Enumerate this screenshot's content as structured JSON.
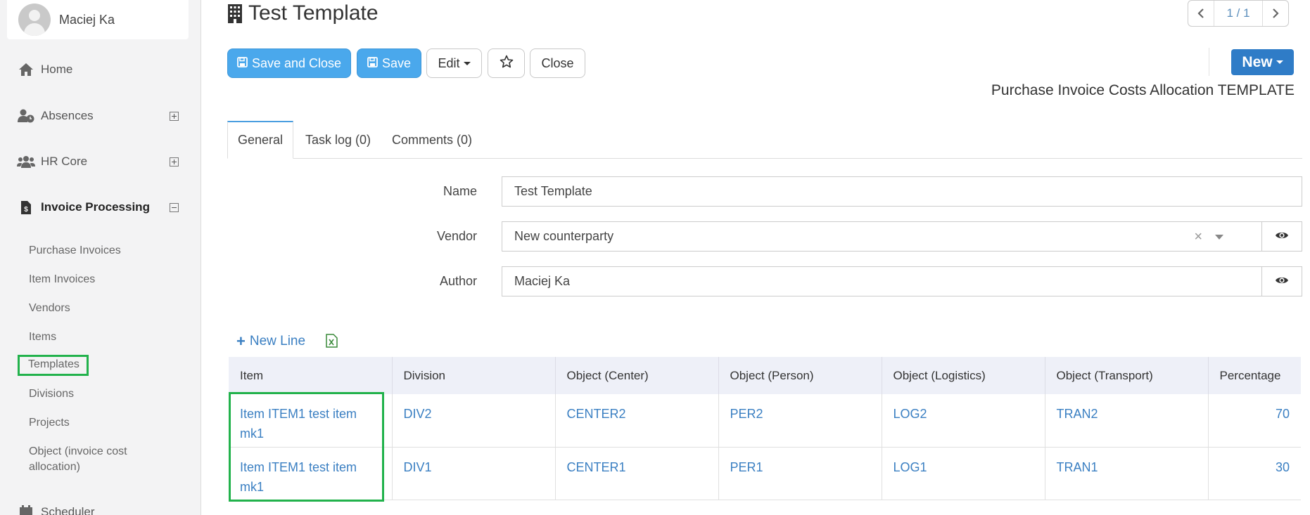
{
  "user": {
    "name": "Maciej Ka"
  },
  "sidebar": {
    "items": [
      {
        "label": "Home",
        "icon": "home-icon"
      },
      {
        "label": "Absences",
        "icon": "user-clock-icon",
        "toggle": "expand"
      },
      {
        "label": "HR Core",
        "icon": "users-icon",
        "toggle": "expand"
      },
      {
        "label": "Invoice Processing",
        "icon": "invoice-dollar-icon",
        "toggle": "collapse"
      }
    ],
    "sub_items": [
      "Purchase Invoices",
      "Item Invoices",
      "Vendors",
      "Items",
      "Templates",
      "Divisions",
      "Projects",
      "Object (invoice cost",
      "allocation)"
    ],
    "bottom_item": "Scheduler"
  },
  "header": {
    "title": "Test Template",
    "title_icon": "building-icon",
    "pager": "1 / 1",
    "subtitle": "Purchase Invoice Costs Allocation TEMPLATE",
    "new_label": "New"
  },
  "toolbar": {
    "save_close": "Save and Close",
    "save": "Save",
    "edit": "Edit",
    "close": "Close"
  },
  "tabs": [
    "General",
    "Task log (0)",
    "Comments (0)"
  ],
  "form": {
    "name_label": "Name",
    "name_value": "Test Template",
    "vendor_label": "Vendor",
    "vendor_value": "New counterparty",
    "author_label": "Author",
    "author_value": "Maciej Ka"
  },
  "table_toolbar": {
    "new_line": "New Line"
  },
  "table": {
    "columns": [
      "Item",
      "Division",
      "Object (Center)",
      "Object (Person)",
      "Object (Logistics)",
      "Object (Transport)",
      "Percentage"
    ],
    "rows": [
      [
        "Item ITEM1 test item mk1",
        "DIV2",
        "CENTER2",
        "PER2",
        "LOG2",
        "TRAN2",
        "70"
      ],
      [
        "Item ITEM1 test item mk1",
        "DIV1",
        "CENTER1",
        "PER1",
        "LOG1",
        "TRAN1",
        "30"
      ]
    ]
  },
  "colors": {
    "primary": "#4aa8ec",
    "new_button": "#2f7cc7",
    "link": "#3a7fc2",
    "highlight": "#22b24c"
  }
}
